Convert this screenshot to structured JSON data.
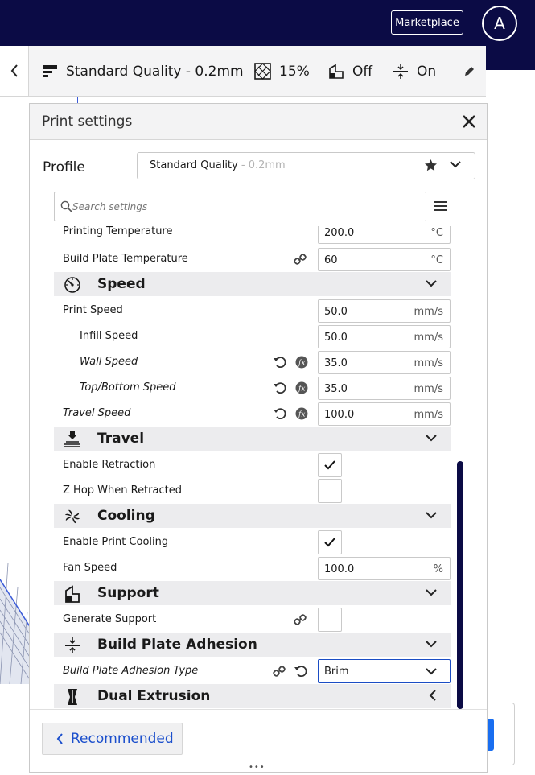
{
  "topbar": {
    "marketplace_label": "Marketplace",
    "avatar_letter": "A"
  },
  "quality_bar": {
    "profile": "Standard Quality - 0.2mm",
    "infill": "15%",
    "support": "Off",
    "adhesion": "On"
  },
  "panel": {
    "title": "Print settings",
    "profile_label": "Profile",
    "profile_name": "Standard Quality",
    "profile_suffix": " - 0.2mm",
    "search_placeholder": "Search settings",
    "recommended_label": "Recommended"
  },
  "settings": {
    "partial_top": {
      "label": "Printing Temperature",
      "value": "200.0",
      "unit": "°C"
    },
    "build_plate_temp": {
      "label": "Build Plate Temperature",
      "value": "60",
      "unit": "°C"
    },
    "speed": {
      "title": "Speed",
      "print_speed": {
        "label": "Print Speed",
        "value": "50.0",
        "unit": "mm/s"
      },
      "infill_speed": {
        "label": "Infill Speed",
        "value": "50.0",
        "unit": "mm/s"
      },
      "wall_speed": {
        "label": "Wall Speed",
        "value": "35.0",
        "unit": "mm/s"
      },
      "topbottom_speed": {
        "label": "Top/Bottom Speed",
        "value": "35.0",
        "unit": "mm/s"
      },
      "travel_speed": {
        "label": "Travel Speed",
        "value": "100.0",
        "unit": "mm/s"
      }
    },
    "travel": {
      "title": "Travel",
      "enable_retraction": {
        "label": "Enable Retraction",
        "checked": true
      },
      "zhop": {
        "label": "Z Hop When Retracted",
        "checked": false
      }
    },
    "cooling": {
      "title": "Cooling",
      "enable_cooling": {
        "label": "Enable Print Cooling",
        "checked": true
      },
      "fan_speed": {
        "label": "Fan Speed",
        "value": "100.0",
        "unit": "%"
      }
    },
    "support": {
      "title": "Support",
      "generate": {
        "label": "Generate Support",
        "checked": false
      }
    },
    "adhesion": {
      "title": "Build Plate Adhesion",
      "type": {
        "label": "Build Plate Adhesion Type",
        "value": "Brim"
      }
    },
    "dual": {
      "title": "Dual Extrusion"
    }
  },
  "colors": {
    "topbar": "#0b0b45",
    "accent": "#1b4fcc",
    "scrollbar": "#0b0b45"
  }
}
